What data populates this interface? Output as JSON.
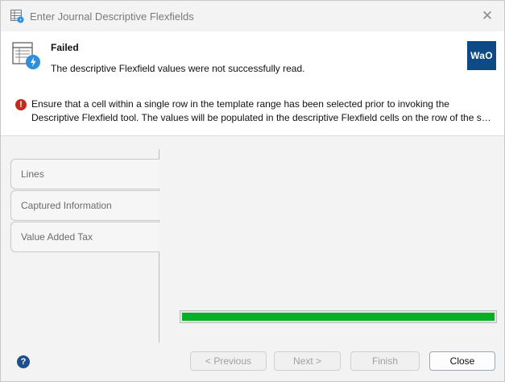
{
  "window": {
    "title": "Enter Journal Descriptive Flexfields",
    "close_glyph": "✕"
  },
  "header": {
    "status_title": "Failed",
    "status_message": "The descriptive Flexfield values were not successfully read.",
    "logo_text": "WaO",
    "error_glyph": "!",
    "error_line1": "Ensure that a cell within a single row in the template range has been selected prior to invoking the",
    "error_line2": "Descriptive Flexfield tool.  The values will be populated in the descriptive Flexfield cells on the row of the selected cell."
  },
  "tabs": [
    {
      "label": "Lines"
    },
    {
      "label": "Captured Information"
    },
    {
      "label": "Value Added Tax"
    }
  ],
  "progress": {
    "value": 1.0,
    "color": "#06b025"
  },
  "footer": {
    "help_glyph": "?",
    "previous_label": "< Previous",
    "next_label": "Next >",
    "finish_label": "Finish",
    "close_label": "Close"
  },
  "colors": {
    "logo_bg": "#0d4a86",
    "error_red": "#c42b1c",
    "help_blue": "#1f4e8c"
  }
}
